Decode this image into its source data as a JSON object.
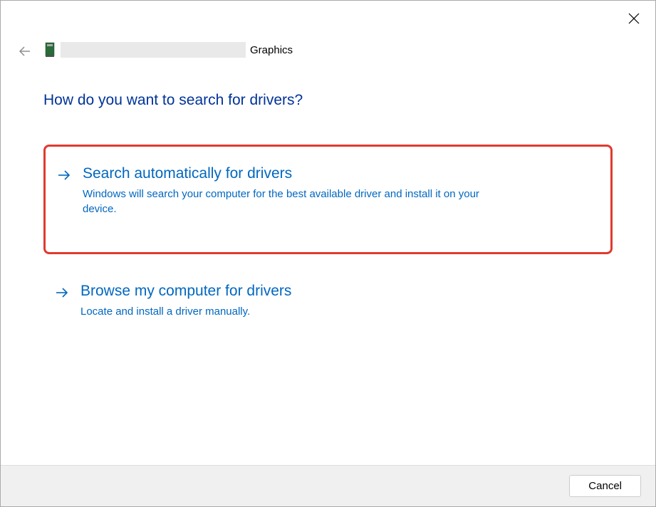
{
  "header": {
    "device_name": "Graphics"
  },
  "main": {
    "heading": "How do you want to search for drivers?",
    "options": [
      {
        "title": "Search automatically for drivers",
        "description": "Windows will search your computer for the best available driver and install it on your device."
      },
      {
        "title": "Browse my computer for drivers",
        "description": "Locate and install a driver manually."
      }
    ]
  },
  "footer": {
    "cancel_label": "Cancel"
  }
}
